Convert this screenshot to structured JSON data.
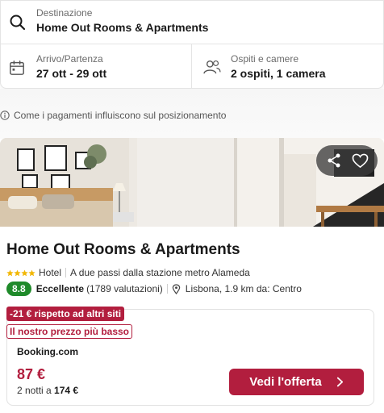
{
  "search": {
    "destination_label": "Destinazione",
    "destination_value": "Home Out Rooms & Apartments",
    "dates_label": "Arrivo/Partenza",
    "dates_value": "27 ott - 29 ott",
    "guests_label": "Ospiti e camere",
    "guests_value": "2 ospiti, 1 camera"
  },
  "info_note": "Come i pagamenti influiscono sul posizionamento",
  "hotel": {
    "name": "Home Out Rooms & Apartments",
    "stars": 4,
    "type": "Hotel",
    "location_note": "A due passi dalla stazione metro Alameda",
    "score": "8.8",
    "rating_word": "Eccellente",
    "reviews": "(1789 valutazioni)",
    "distance": "Lisbona, 1.9 km da: Centro"
  },
  "offer": {
    "discount_tag": "-21 € rispetto ad altri siti",
    "best_price_tag": "Il nostro prezzo più basso",
    "provider": "Booking.com",
    "price": "87 €",
    "nights_prefix": "2 notti a",
    "total": "174 €",
    "cta_label": "Vedi l'offerta"
  },
  "colors": {
    "accent": "#b21e3e",
    "rating_green": "#1f8a2a",
    "star_gold": "#f2b705"
  },
  "icons": [
    "search-icon",
    "calendar-icon",
    "guests-icon",
    "info-icon",
    "share-icon",
    "heart-icon",
    "star-icon",
    "location-pin-icon",
    "chevron-right-icon"
  ]
}
